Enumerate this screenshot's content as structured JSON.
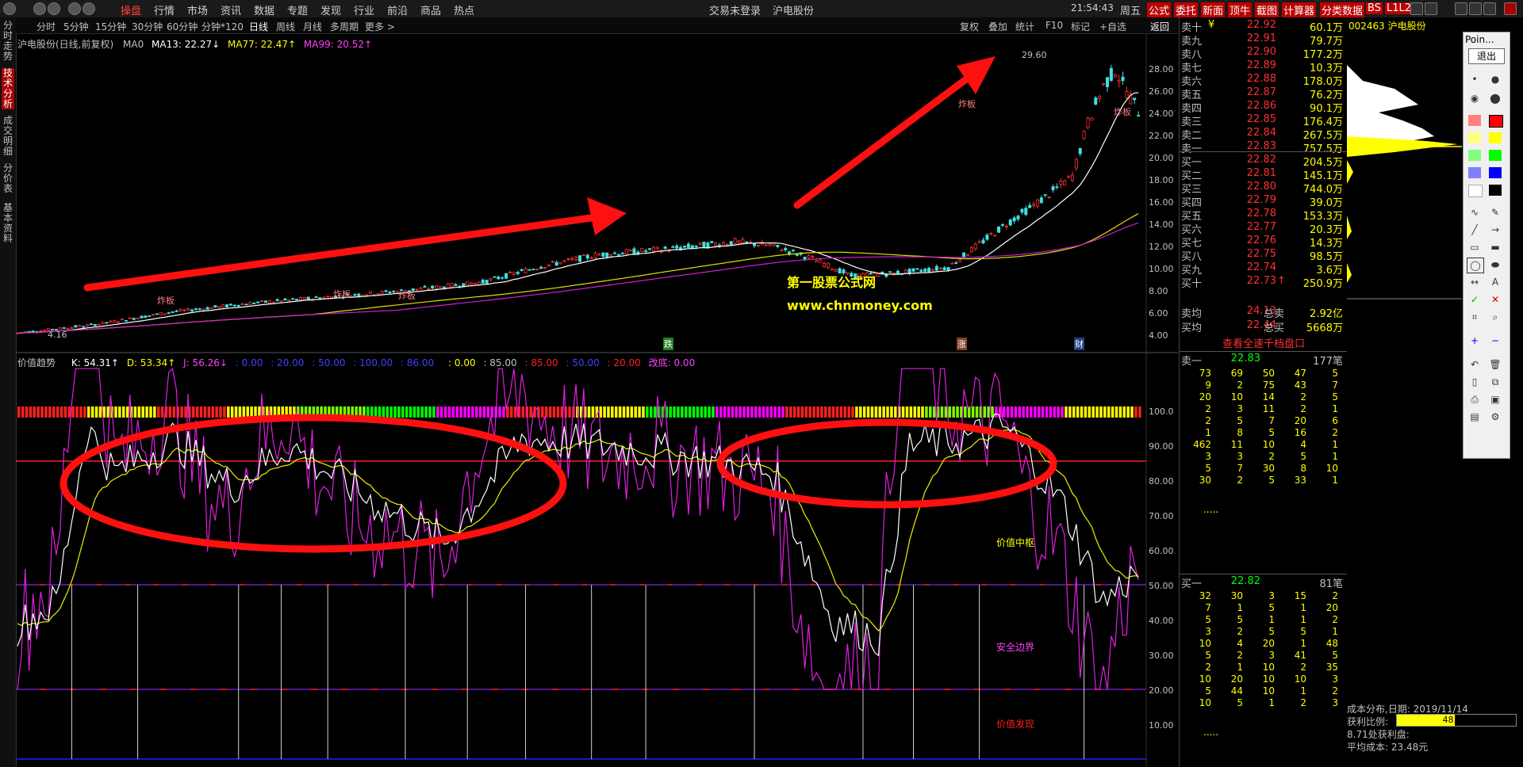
{
  "menu": {
    "main": [
      "操盘",
      "行情",
      "市场",
      "资讯",
      "数据",
      "专题",
      "发现",
      "行业",
      "前沿",
      "商品",
      "热点"
    ],
    "center_status": "交易未登录",
    "center_name": "沪电股份",
    "clock": "21:54:43",
    "weekday": "周五",
    "right_tabs": [
      "公式",
      "委托",
      "新面",
      "顶牛",
      "截图",
      "计算器",
      "分类数据",
      "BS",
      "L1L2"
    ]
  },
  "periods": [
    "分时",
    "5分钟",
    "15分钟",
    "30分钟",
    "60分钟",
    "分钟*120",
    "日线",
    "周线",
    "月线",
    "多周期",
    "更多 >"
  ],
  "period_right": [
    "复权",
    "叠加",
    "统计",
    "F10",
    "标记",
    "+自选",
    "返回"
  ],
  "left_tabs": [
    "分时走势",
    "技术分析",
    "成交明细",
    "分价表",
    "基本资料"
  ],
  "main_chart": {
    "title": "沪电股份(日线,前复权)",
    "ma_labels": {
      "ma0": "MA0",
      "ma13": "MA13: 22.27↓",
      "ma77": "MA77: 22.47↑",
      "ma99": "MA99: 20.52↑"
    },
    "y_ticks": [
      "28.00",
      "26.00",
      "24.00",
      "22.00",
      "20.00",
      "18.00",
      "16.00",
      "14.00",
      "12.00",
      "10.00",
      "8.00",
      "6.00",
      "4.00"
    ],
    "high_label": "29.60",
    "low_label": "4.16",
    "annotations": [
      "炸板",
      "炸板",
      "炸板",
      "炸板",
      "炸板"
    ],
    "watermark_name": "第一股票公式网",
    "watermark_url": "www.chnmoney.com",
    "bottom_marks": [
      "跌",
      "涨",
      "财"
    ]
  },
  "sub_chart": {
    "title": "价值趋势",
    "kdj": {
      "k": "K: 54.31↑",
      "d": "D: 53.34↑",
      "j": "J: 56.26↓"
    },
    "params": [
      ": 0.00",
      ": 20.00",
      ": 50.00",
      ": 100.00",
      ": 86.00",
      ": 0.00",
      ": 85.00",
      ": 85.00",
      ": 50.00",
      ": 20.00",
      "改底: 0.00"
    ],
    "y_ticks": [
      "100.0",
      "90.00",
      "80.00",
      "70.00",
      "60.00",
      "50.00",
      "40.00",
      "30.00",
      "20.00",
      "10.00"
    ],
    "labels": {
      "mid": "价值中枢",
      "safe": "安全边界",
      "find": "价值发现"
    }
  },
  "order_book": {
    "sell": [
      {
        "label": "卖十",
        "mark": "¥",
        "price": "22.92",
        "pc": "#ff3030",
        "vol": "60.1万"
      },
      {
        "label": "卖九",
        "price": "22.91",
        "pc": "#ff3030",
        "vol": "79.7万"
      },
      {
        "label": "卖八",
        "price": "22.90",
        "pc": "#ff3030",
        "vol": "177.2万"
      },
      {
        "label": "卖七",
        "price": "22.89",
        "pc": "#ff3030",
        "vol": "10.3万"
      },
      {
        "label": "卖六",
        "price": "22.88",
        "pc": "#ff3030",
        "vol": "178.0万"
      },
      {
        "label": "卖五",
        "price": "22.87",
        "pc": "#ff3030",
        "vol": "76.2万"
      },
      {
        "label": "卖四",
        "price": "22.86",
        "pc": "#ff3030",
        "vol": "90.1万"
      },
      {
        "label": "卖三",
        "price": "22.85",
        "pc": "#ff3030",
        "vol": "176.4万"
      },
      {
        "label": "卖二",
        "price": "22.84",
        "pc": "#ff3030",
        "vol": "267.5万"
      },
      {
        "label": "卖一",
        "price": "22.83",
        "pc": "#ff3030",
        "vol": "757.5万"
      }
    ],
    "buy": [
      {
        "label": "买一",
        "price": "22.82",
        "pc": "#ff3030",
        "vol": "204.5万"
      },
      {
        "label": "买二",
        "price": "22.81",
        "pc": "#ff3030",
        "vol": "145.1万"
      },
      {
        "label": "买三",
        "price": "22.80",
        "pc": "#ff3030",
        "vol": "744.0万"
      },
      {
        "label": "买四",
        "price": "22.79",
        "pc": "#ff3030",
        "vol": "39.0万"
      },
      {
        "label": "买五",
        "price": "22.78",
        "pc": "#ff3030",
        "vol": "153.3万"
      },
      {
        "label": "买六",
        "price": "22.77",
        "pc": "#ff3030",
        "vol": "20.3万"
      },
      {
        "label": "买七",
        "price": "22.76",
        "pc": "#ff3030",
        "vol": "14.3万"
      },
      {
        "label": "买八",
        "price": "22.75",
        "pc": "#ff3030",
        "vol": "98.5万"
      },
      {
        "label": "买九",
        "price": "22.74",
        "pc": "#ff3030",
        "vol": "3.6万"
      },
      {
        "label": "买十",
        "mark": "↑",
        "price": "22.73",
        "pc": "#ff3030",
        "vol": "250.9万"
      }
    ],
    "avg_sell": {
      "label": "卖均",
      "price": "24.13",
      "total_label": "总卖",
      "total": "2.92亿"
    },
    "avg_buy": {
      "label": "买均",
      "price": "22.44",
      "total_label": "总买",
      "total": "5668万"
    },
    "link": "查看全速千档盘口",
    "sell1_queue": {
      "label": "卖一",
      "price": "22.83",
      "count": "177笔",
      "rows": [
        [
          "73",
          "69",
          "50",
          "47",
          "5"
        ],
        [
          "9",
          "2",
          "75",
          "43",
          "7"
        ],
        [
          "20",
          "10",
          "14",
          "2",
          "5"
        ],
        [
          "2",
          "3",
          "11",
          "2",
          "1"
        ],
        [
          "2",
          "5",
          "7",
          "20",
          "6"
        ],
        [
          "1",
          "8",
          "5",
          "16",
          "2"
        ],
        [
          "462",
          "11",
          "10",
          "4",
          "1"
        ],
        [
          "3",
          "3",
          "2",
          "5",
          "1"
        ],
        [
          "5",
          "7",
          "30",
          "8",
          "10"
        ],
        [
          "30",
          "2",
          "5",
          "33",
          "1"
        ]
      ]
    },
    "buy1_queue": {
      "label": "买一",
      "price": "22.82",
      "count": "81笔",
      "rows": [
        [
          "32",
          "30",
          "3",
          "15",
          "2"
        ],
        [
          "7",
          "1",
          "5",
          "1",
          "20"
        ],
        [
          "5",
          "5",
          "1",
          "1",
          "2"
        ],
        [
          "3",
          "2",
          "5",
          "5",
          "1"
        ],
        [
          "10",
          "4",
          "20",
          "1",
          "48"
        ],
        [
          "5",
          "2",
          "3",
          "41",
          "5"
        ],
        [
          "2",
          "1",
          "10",
          "2",
          "35"
        ],
        [
          "10",
          "20",
          "10",
          "10",
          "3"
        ],
        [
          "5",
          "44",
          "10",
          "1",
          "2"
        ],
        [
          "10",
          "5",
          "1",
          "2",
          "3"
        ]
      ]
    },
    "ellipsis": "....."
  },
  "right": {
    "code": "002463",
    "name": "沪电股份",
    "tool_title": "Poin...",
    "tool_exit": "退出",
    "cost_title": "成本分布,日期: 2019/11/14",
    "profit_label": "获利比例:",
    "profit_value": "48.4%",
    "profit_fill": 0.484,
    "profit_line": "8.71处获利盘:",
    "avg_cost": "平均成本: 23.48元"
  }
}
